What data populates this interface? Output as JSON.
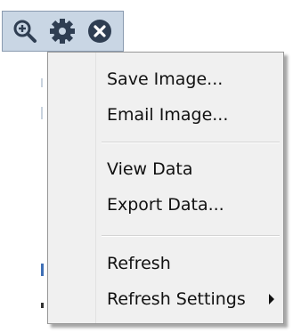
{
  "toolbar": {
    "icons": [
      "zoom-in-icon",
      "gear-icon",
      "close-circle-icon"
    ],
    "icon_color": "#2f3e52",
    "background": "#c9d6e4"
  },
  "menu": {
    "groups": [
      {
        "items": [
          {
            "label": "Save Image..."
          },
          {
            "label": "Email Image..."
          }
        ]
      },
      {
        "items": [
          {
            "label": "View Data"
          },
          {
            "label": "Export Data..."
          }
        ]
      },
      {
        "items": [
          {
            "label": "Refresh"
          },
          {
            "label": "Refresh Settings",
            "has_submenu": true
          }
        ]
      }
    ]
  }
}
